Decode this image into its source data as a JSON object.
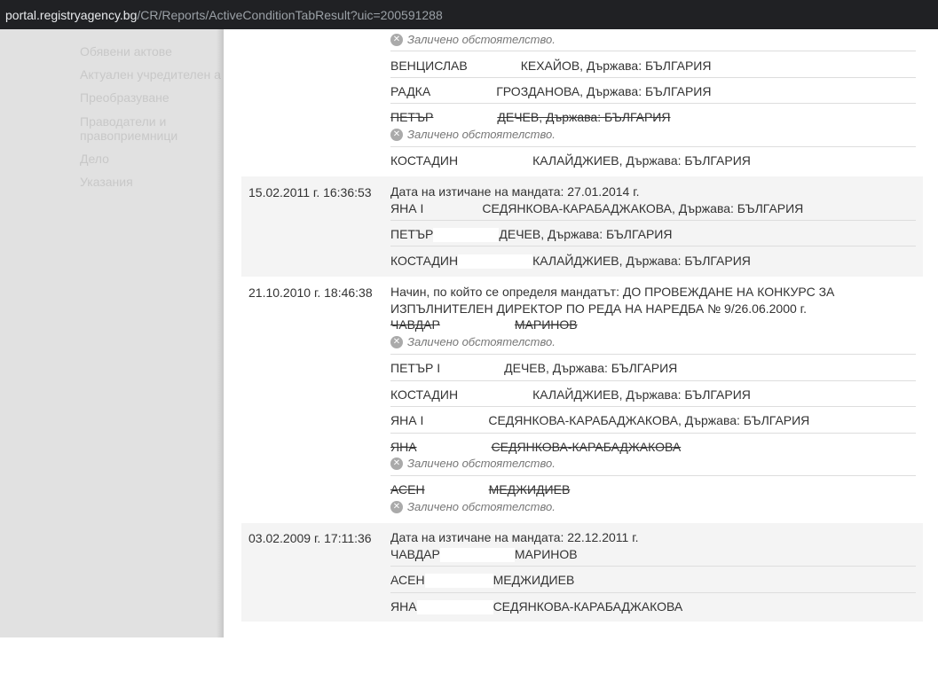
{
  "browser": {
    "url_domain": "portal.registryagency.bg",
    "url_path": "/CR/Reports/ActiveConditionTabResult?uic=200591288"
  },
  "sidebar": {
    "items": [
      "Обявени актове",
      "Актуален учредителен а",
      "Преобразуване",
      "Праводатели и",
      "правоприемници",
      "Дело",
      "Указания"
    ]
  },
  "deleted_label": "Заличено обстоятелство.",
  "top_entries": [
    "ВЕНЦИСЛАВ",
    "КЕХАЙОВ, Държава: БЪЛГАРИЯ",
    "РАДКА",
    "ГРОЗДАНОВА, Държава: БЪЛГАРИЯ",
    "ПЕТЪР",
    "ДЕЧЕВ, Държава: БЪЛГАРИЯ",
    "КОСТАДИН",
    "КАЛАЙДЖИЕВ, Държава: БЪЛГАРИЯ"
  ],
  "records": [
    {
      "date": "15.02.2011 г. 16:36:53",
      "note": "Дата на изтичане на мандата: 27.01.2014 г.",
      "people": [
        {
          "first": "ЯНА І",
          "last": "СЕДЯНКОВА-КАРАБАДЖАКОВА, Държава: БЪЛГАРИЯ"
        },
        {
          "first": "ПЕТЪР",
          "last": "ДЕЧЕВ, Държава: БЪЛГАРИЯ"
        },
        {
          "first": "КОСТАДИН",
          "last": "КАЛАЙДЖИЕВ, Държава: БЪЛГАРИЯ"
        }
      ]
    },
    {
      "date": "21.10.2010 г. 18:46:38",
      "note1": "Начин, по който се определя мандатът: ДО ПРОВЕЖДАНЕ НА КОНКУРС ЗА",
      "note2": "ИЗПЪЛНИТЕЛЕН ДИРЕКТОР ПО РЕДА НА НАРЕДБА № 9/26.06.2000 г.",
      "people": [
        {
          "first": "ЧАВДАР",
          "last": "МАРИНОВ"
        },
        {
          "first": "ПЕТЪР І",
          "last": "ДЕЧЕВ, Държава: БЪЛГАРИЯ"
        },
        {
          "first": "КОСТАДИН",
          "last": "КАЛАЙДЖИЕВ, Държава: БЪЛГАРИЯ"
        },
        {
          "first": "ЯНА І",
          "last": "СЕДЯНКОВА-КАРАБАДЖАКОВА, Държава: БЪЛГАРИЯ"
        },
        {
          "first": "ЯНА",
          "last": "СЕДЯНКОВА-КАРАБАДЖАКОВА"
        },
        {
          "first": "АСЕН",
          "last": "МЕДЖИДИЕВ"
        }
      ]
    },
    {
      "date": "03.02.2009 г. 17:11:36",
      "note": "Дата на изтичане на мандата: 22.12.2011 г.",
      "people": [
        {
          "first": "ЧАВДАР",
          "last": "МАРИНОВ"
        },
        {
          "first": "АСЕН",
          "last": "МЕДЖИДИЕВ"
        },
        {
          "first": "ЯНА",
          "last": "СЕДЯНКОВА-КАРАБАДЖАКОВА"
        }
      ]
    }
  ]
}
